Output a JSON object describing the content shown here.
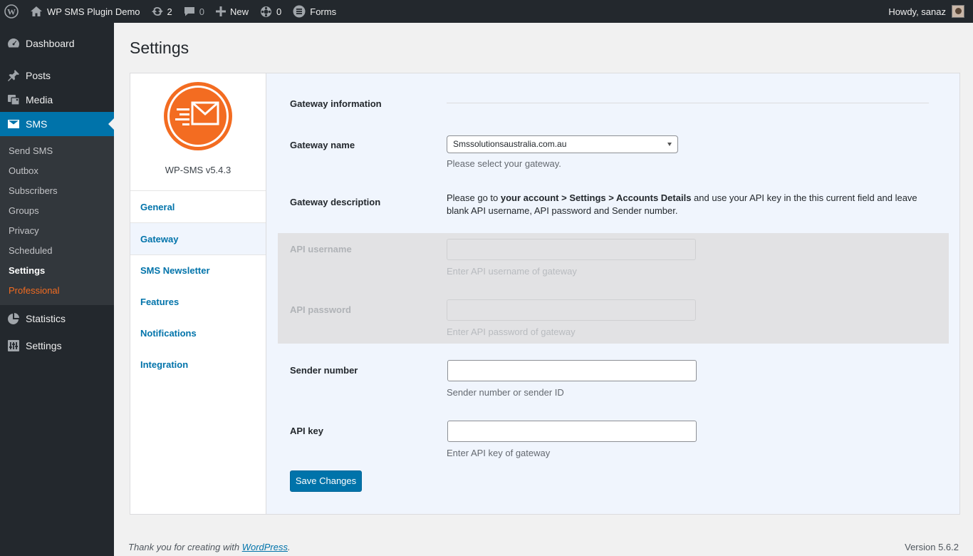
{
  "admin_bar": {
    "site_name": "WP SMS Plugin Demo",
    "updates_count": "2",
    "comments_count": "0",
    "new_label": "New",
    "badge_count": "0",
    "forms_label": "Forms",
    "howdy": "Howdy, sanaz"
  },
  "sidebar": {
    "items": [
      {
        "label": "Dashboard",
        "icon": "dashboard-icon"
      },
      {
        "label": "Posts",
        "icon": "pin-icon"
      },
      {
        "label": "Media",
        "icon": "media-icon"
      },
      {
        "label": "SMS",
        "icon": "envelope-icon"
      },
      {
        "label": "Statistics",
        "icon": "pie-chart-icon"
      },
      {
        "label": "Settings",
        "icon": "settings-icon"
      }
    ],
    "submenu": [
      "Send SMS",
      "Outbox",
      "Subscribers",
      "Groups",
      "Privacy",
      "Scheduled",
      "Settings",
      "Professional"
    ]
  },
  "page": {
    "title": "Settings",
    "plugin_version": "WP-SMS v5.4.3",
    "tabs": [
      "General",
      "Gateway",
      "SMS Newsletter",
      "Features",
      "Notifications",
      "Integration"
    ],
    "active_tab": "Gateway"
  },
  "form": {
    "gateway_info_label": "Gateway information",
    "gateway_name_label": "Gateway name",
    "gateway_name_value": "Smssolutionsaustralia.com.au",
    "gateway_name_desc": "Please select your gateway.",
    "gateway_desc_label": "Gateway description",
    "gateway_desc_1": "Please go to ",
    "gateway_desc_bold": "your account > Settings > Accounts Details",
    "gateway_desc_2": " and use your API key in the this current field and leave blank API username, API password and Sender number.",
    "api_username_label": "API username",
    "api_username_desc": "Enter API username of gateway",
    "api_password_label": "API password",
    "api_password_desc": "Enter API password of gateway",
    "sender_label": "Sender number",
    "sender_desc": "Sender number or sender ID",
    "api_key_label": "API key",
    "api_key_desc": "Enter API key of gateway",
    "save_label": "Save Changes"
  },
  "footer": {
    "thanks_prefix": "Thank you for creating with ",
    "thanks_link": "WordPress",
    "thanks_suffix": ".",
    "version": "Version 5.6.2"
  },
  "colors": {
    "accent": "#0073aa",
    "brand_orange": "#f36c21",
    "admin_dark": "#23282d"
  }
}
